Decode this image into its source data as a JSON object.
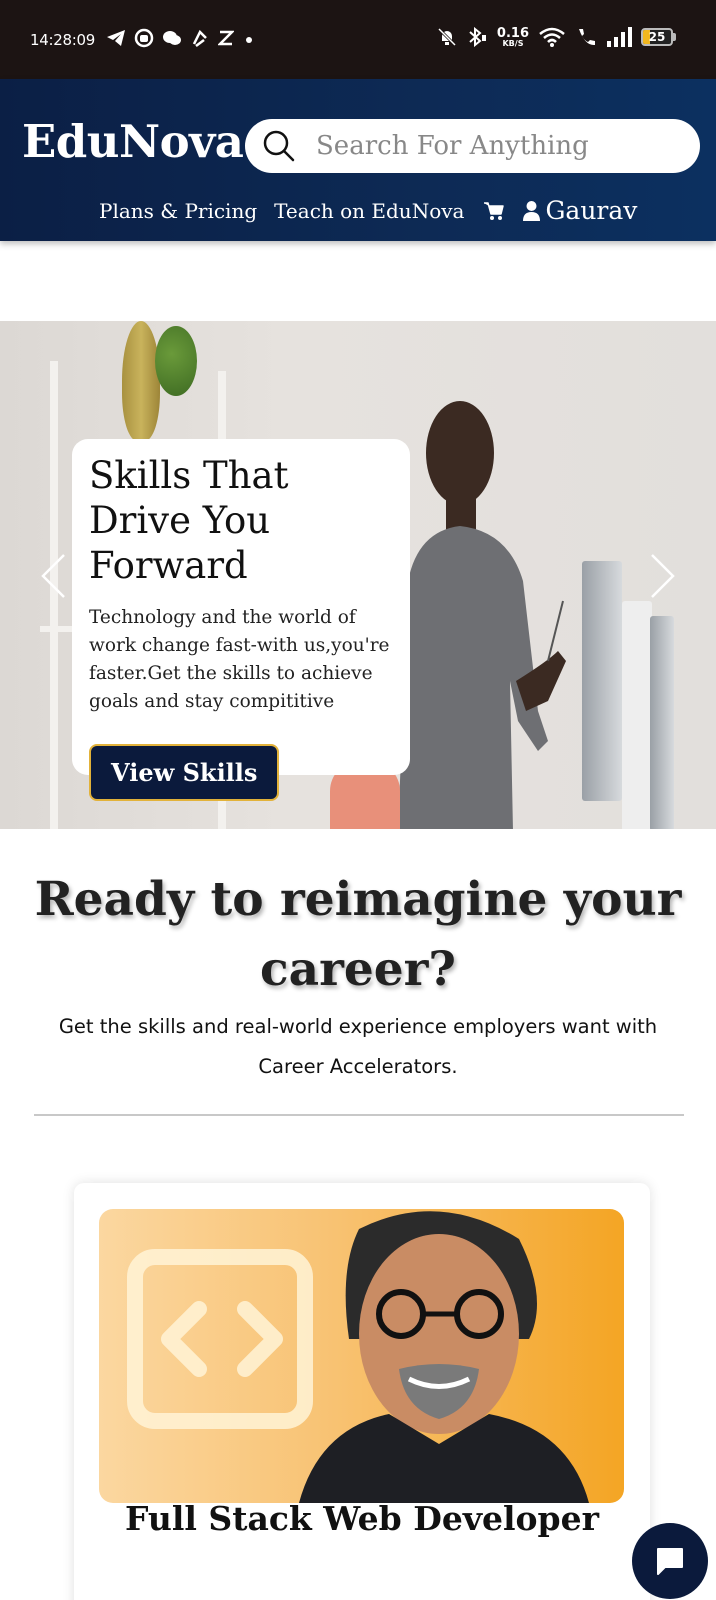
{
  "status_bar": {
    "time": "14:28:09",
    "left_icons": [
      "telegram-icon",
      "circle-app-icon",
      "cloud-chat-icon",
      "signal-arrow-icon",
      "z-icon",
      "dot-icon"
    ],
    "net_speed": "0.16",
    "net_speed_unit": "KB/S",
    "battery": "25",
    "battery_level_percent": 25,
    "battery_color": "#f1b71f"
  },
  "header": {
    "brand": "EduNova",
    "search_placeholder": "Search For Anything",
    "nav": {
      "plans": "Plans & Pricing",
      "teach": "Teach on EduNova",
      "user": "Gaurav"
    },
    "bg_color": "#0b1f45"
  },
  "hero": {
    "title": "Skills That Drive You Forward",
    "description": "Technology and the world of work change fast-with us,you're faster.Get the skills to achieve goals and stay compititive",
    "button": "View Skills",
    "button_color": "#0b1a3c",
    "button_border": "#e2b23a"
  },
  "intro": {
    "title": "Ready to reimagine your career?",
    "subtitle": "Get the skills and real-world experience employers want with Career Accelerators."
  },
  "course": {
    "title": "Full Stack Web Developer",
    "image_icon": "code-brackets-icon"
  },
  "chat": {
    "icon": "chat-bubble-icon"
  }
}
